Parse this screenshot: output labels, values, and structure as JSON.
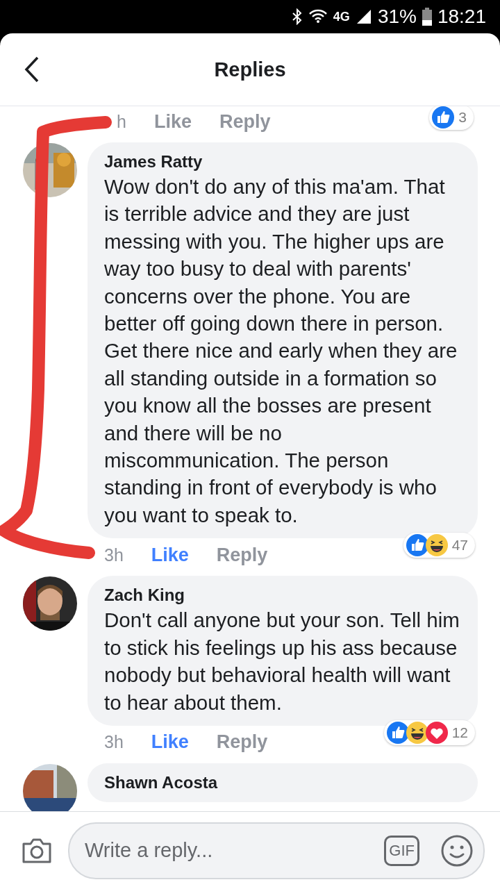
{
  "status_bar": {
    "network": "4G",
    "battery": "31%",
    "time": "18:21"
  },
  "header": {
    "title": "Replies"
  },
  "previous_actions": {
    "time": "h",
    "like": "Like",
    "reply": "Reply",
    "liked": false,
    "reactions": [
      {
        "kind": "like"
      }
    ],
    "reaction_count": "3"
  },
  "comments": [
    {
      "author": "James Ratty",
      "text": "Wow don't do any of this ma'am. That is terrible advice and they are just messing with you. The higher ups are way too busy to deal with parents' concerns over the phone. You are better off going down there in person. Get there nice and early when they are all standing outside in a formation so you know all the bosses are present and there will be no miscommunication. The person standing in front of everybody is who you want to speak to.",
      "time": "3h",
      "like": "Like",
      "reply": "Reply",
      "liked": true,
      "reactions": [
        {
          "kind": "like"
        },
        {
          "kind": "haha"
        }
      ],
      "reaction_count": "47"
    },
    {
      "author": "Zach King",
      "text": "Don't call anyone but your son. Tell him to stick his feelings up his ass because nobody but behavioral health will want to hear about them.",
      "time": "3h",
      "like": "Like",
      "reply": "Reply",
      "liked": true,
      "reactions": [
        {
          "kind": "like"
        },
        {
          "kind": "haha"
        },
        {
          "kind": "love"
        }
      ],
      "reaction_count": "12"
    },
    {
      "author": "Shawn Acosta"
    }
  ],
  "composer": {
    "placeholder": "Write a reply...",
    "gif_label": "GIF"
  }
}
